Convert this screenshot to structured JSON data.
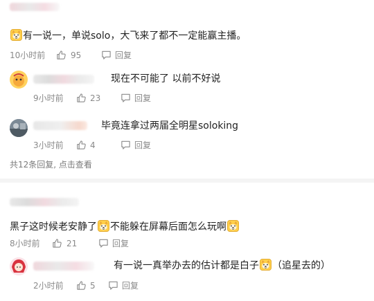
{
  "threads": [
    {
      "comment": {
        "text_parts": [
          "有一说一，单说solo，大飞来了都不一定能赢主播。"
        ],
        "time": "10小时前",
        "likes": "95",
        "reply_label": "回复"
      },
      "replies": [
        {
          "text_parts": [
            "现在不可能了 以前不好说"
          ],
          "time": "9小时前",
          "likes": "23",
          "reply_label": "回复"
        },
        {
          "text_parts": [
            "毕竟连拿过两届全明星soloking"
          ],
          "time": "3小时前",
          "likes": "4",
          "reply_label": "回复"
        }
      ],
      "view_all": "共12条回复, 点击查看"
    },
    {
      "comment": {
        "text_parts": [
          "黑子这时候老安静了",
          "不能躲在屏幕后面怎么玩啊"
        ],
        "time": "8小时前",
        "likes": "21",
        "reply_label": "回复"
      },
      "replies": [
        {
          "text_parts": [
            "有一说一真举办去的估计都是白子",
            "（追星去的）"
          ],
          "time": "2小时前",
          "likes": "5",
          "reply_label": "回复"
        }
      ]
    }
  ],
  "icons": {
    "emoji": "doge-emoji",
    "like": "thumbs-up-icon",
    "reply": "reply-icon"
  },
  "colors": {
    "meta": "#8a8a8a",
    "emoji": "#f2b632"
  }
}
